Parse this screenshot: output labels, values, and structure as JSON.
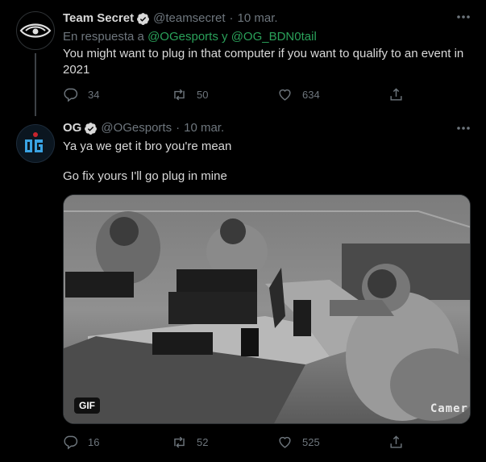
{
  "tweet1": {
    "name": "Team Secret",
    "handle": "@teamsecret",
    "sep": "·",
    "date": "10 mar.",
    "reply_prefix": "En respuesta a",
    "reply_user1": "@OGesports",
    "reply_and": "y",
    "reply_user2": "@OG_BDN0tail",
    "text": "You might want to plug in that computer if you want to qualify to an event in 2021",
    "replies": "34",
    "retweets": "50",
    "likes": "634"
  },
  "tweet2": {
    "name": "OG",
    "handle": "@OGesports",
    "sep": "·",
    "date": "10 mar.",
    "text_line1": "Ya ya we get it bro you're mean",
    "text_line2": "Go fix yours I'll go plug in mine",
    "media_badge": "GIF",
    "media_overlay_text": "Camer",
    "replies": "16",
    "retweets": "52",
    "likes": "525"
  },
  "colors": {
    "background": "#000000",
    "text": "#d9d9d9",
    "muted": "#6e767d",
    "mention": "#2aa15a",
    "verified": "#d9d9d9"
  },
  "icons": [
    "more-icon",
    "verified-icon",
    "reply-icon",
    "retweet-icon",
    "like-icon",
    "share-icon"
  ]
}
